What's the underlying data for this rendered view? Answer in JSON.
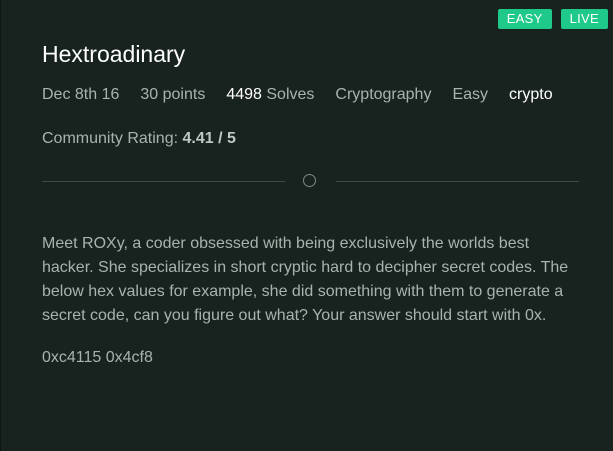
{
  "badges": {
    "difficulty": "EASY",
    "status": "LIVE"
  },
  "challenge": {
    "title": "Hextroadinary",
    "date": "Dec 8th 16",
    "points": "30 points",
    "solves_count": "4498",
    "solves_label": "Solves",
    "category": "Cryptography",
    "difficulty": "Easy",
    "tag": "crypto"
  },
  "rating": {
    "label": "Community Rating:",
    "value": "4.41 / 5"
  },
  "description": "Meet ROXy, a coder obsessed with being exclusively the worlds best hacker. She specializes in short cryptic hard to decipher secret codes. The below hex values for example, she did something with them to generate a secret code, can you figure out what? Your answer should start with 0x.",
  "hex_values": "0xc4115 0x4cf8",
  "colors": {
    "background": "#18231f",
    "accent": "#1fc989",
    "text": "#a9b3ae",
    "title": "#ffffff"
  }
}
